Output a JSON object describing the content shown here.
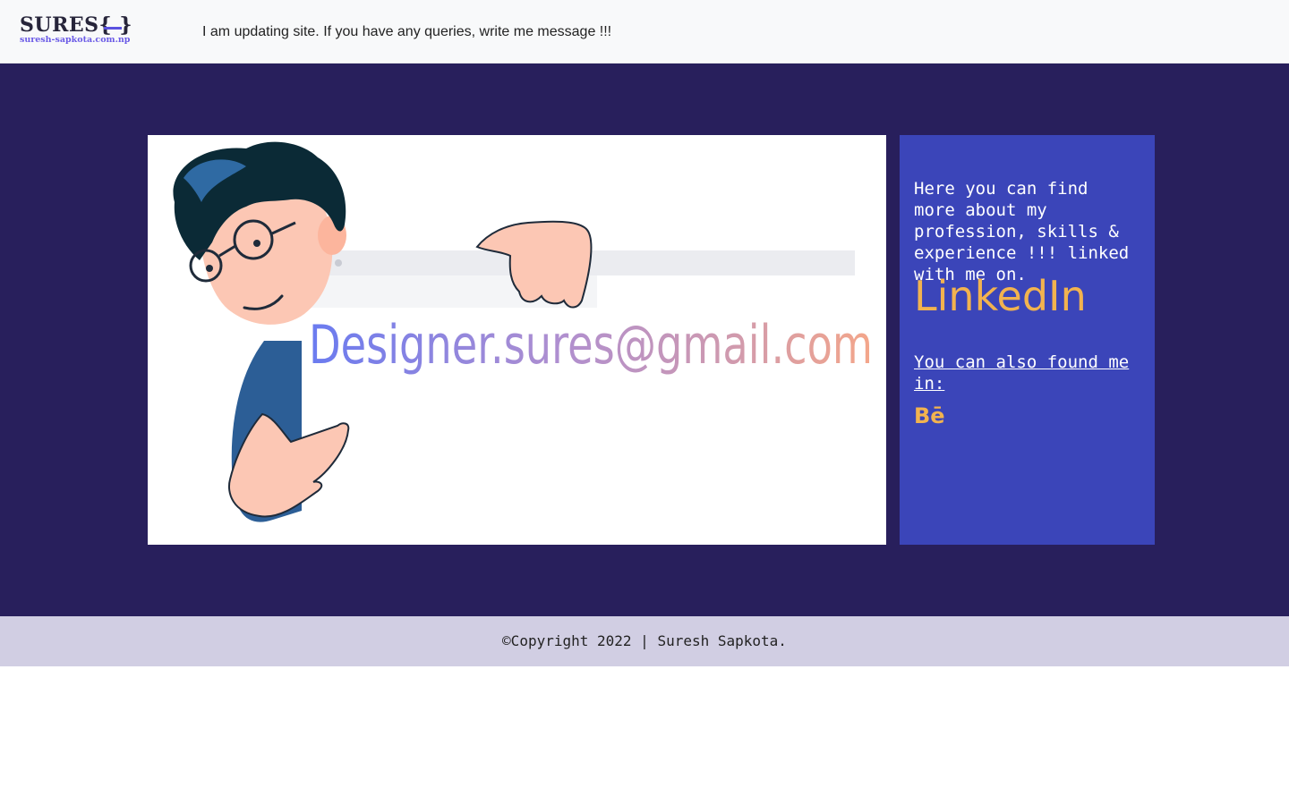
{
  "header": {
    "logo_text": "SURES",
    "logo_braces": "{ }",
    "logo_subtext": "suresh-sapkota.com.np",
    "notice": "I am updating site. If you have any queries, write me message !!!"
  },
  "hero": {
    "email": "Designer.sures@gmail.com",
    "sidebar": {
      "intro": "Here you can find more about my profession, skills & experience !!! linked with me on.",
      "linkedin_label": "LinkedIn",
      "also_label": "You can also found me in:",
      "behance_label": "Bē"
    }
  },
  "footer": {
    "copyright": "©Copyright 2022 | Suresh Sapkota."
  },
  "colors": {
    "header_bg": "#f8f9fa",
    "hero_bg": "#281f5c",
    "sidebar_bg": "#3b45b9",
    "accent_orange": "#f2b34f",
    "footer_bg": "#d1cee3",
    "email_gradient_start": "#6a7bf0",
    "email_gradient_end": "#f4a68a"
  },
  "icons": {
    "behance": "behance-icon",
    "illustration": "pointing-man-illustration"
  }
}
